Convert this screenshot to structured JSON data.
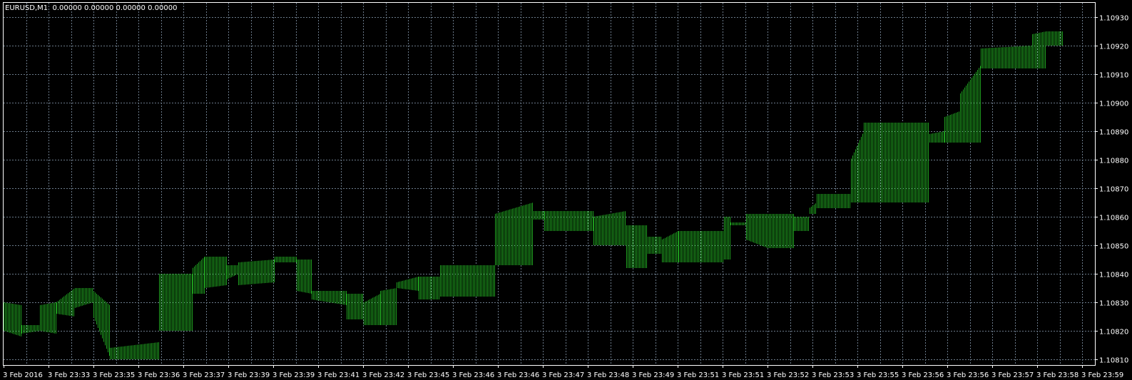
{
  "window": {
    "symbol_title": "EURUSD,M1  0.00000 0.00000 0.00000 0.00000"
  },
  "colors": {
    "background": "#000000",
    "grid": "#6b7a8a",
    "frame": "#ffffff",
    "bar": "#1f9e1f",
    "text": "#ffffff"
  },
  "price_axis": {
    "labels": [
      "1.10930",
      "1.10920",
      "1.10910",
      "1.10900",
      "1.10890",
      "1.10880",
      "1.10870",
      "1.10860",
      "1.10850",
      "1.10840",
      "1.10830",
      "1.10820",
      "1.10810"
    ],
    "min": 1.10808,
    "max": 1.10935
  },
  "time_axis": {
    "labels": [
      "3 Feb 2016",
      "3 Feb 23:33",
      "3 Feb 23:35",
      "3 Feb 23:36",
      "3 Feb 23:37",
      "3 Feb 23:39",
      "3 Feb 23:39",
      "3 Feb 23:41",
      "3 Feb 23:42",
      "3 Feb 23:45",
      "3 Feb 23:46",
      "3 Feb 23:46",
      "3 Feb 23:47",
      "3 Feb 23:48",
      "3 Feb 23:49",
      "3 Feb 23:51",
      "3 Feb 23:51",
      "3 Feb 23:52",
      "3 Feb 23:53",
      "3 Feb 23:55",
      "3 Feb 23:56",
      "3 Feb 23:56",
      "3 Feb 23:57",
      "3 Feb 23:58",
      "3 Feb 23:59"
    ]
  },
  "chart_data": {
    "type": "bar",
    "symbol": "EURUSD",
    "timeframe": "M1",
    "grid": true,
    "price_range": [
      1.10808,
      1.10935
    ],
    "bar_color": "#1f9e1f",
    "segments": [
      {
        "from": 0,
        "to": 0.016,
        "start_low": 1.1082,
        "start_high": 1.1083,
        "end_low": 1.10818,
        "end_high": 1.10829
      },
      {
        "from": 0.016,
        "to": 0.033,
        "start_low": 1.10819,
        "start_high": 1.10822,
        "end_low": 1.1082,
        "end_high": 1.10822
      },
      {
        "from": 0.033,
        "to": 0.048,
        "start_low": 1.1082,
        "start_high": 1.10829,
        "end_low": 1.10819,
        "end_high": 1.1083
      },
      {
        "from": 0.048,
        "to": 0.065,
        "start_low": 1.10826,
        "start_high": 1.1083,
        "end_low": 1.10825,
        "end_high": 1.10835
      },
      {
        "from": 0.065,
        "to": 0.082,
        "start_low": 1.10828,
        "start_high": 1.10835,
        "end_low": 1.1083,
        "end_high": 1.10835
      },
      {
        "from": 0.082,
        "to": 0.097,
        "start_low": 1.10825,
        "start_high": 1.10834,
        "end_low": 1.10811,
        "end_high": 1.10829
      },
      {
        "from": 0.097,
        "to": 0.142,
        "start_low": 1.1081,
        "start_high": 1.10814,
        "end_low": 1.1081,
        "end_high": 1.10816
      },
      {
        "from": 0.142,
        "to": 0.173,
        "start_low": 1.1082,
        "start_high": 1.1084,
        "end_low": 1.1082,
        "end_high": 1.1084
      },
      {
        "from": 0.173,
        "to": 0.184,
        "start_low": 1.10833,
        "start_high": 1.10842,
        "end_low": 1.10833,
        "end_high": 1.10846
      },
      {
        "from": 0.184,
        "to": 0.204,
        "start_low": 1.10835,
        "start_high": 1.10846,
        "end_low": 1.10836,
        "end_high": 1.10846
      },
      {
        "from": 0.204,
        "to": 0.215,
        "start_low": 1.10838,
        "start_high": 1.10843,
        "end_low": 1.1084,
        "end_high": 1.10843
      },
      {
        "from": 0.215,
        "to": 0.248,
        "start_low": 1.10836,
        "start_high": 1.10844,
        "end_low": 1.10837,
        "end_high": 1.10845
      },
      {
        "from": 0.248,
        "to": 0.268,
        "start_low": 1.10844,
        "start_high": 1.10846,
        "end_low": 1.10844,
        "end_high": 1.10846
      },
      {
        "from": 0.268,
        "to": 0.282,
        "start_low": 1.10834,
        "start_high": 1.10845,
        "end_low": 1.10833,
        "end_high": 1.10845
      },
      {
        "from": 0.282,
        "to": 0.314,
        "start_low": 1.10831,
        "start_high": 1.10834,
        "end_low": 1.10829,
        "end_high": 1.10834
      },
      {
        "from": 0.314,
        "to": 0.33,
        "start_low": 1.10824,
        "start_high": 1.10833,
        "end_low": 1.10824,
        "end_high": 1.10833
      },
      {
        "from": 0.33,
        "to": 0.345,
        "start_low": 1.10822,
        "start_high": 1.1083,
        "end_low": 1.10822,
        "end_high": 1.10833
      },
      {
        "from": 0.345,
        "to": 0.36,
        "start_low": 1.10822,
        "start_high": 1.10834,
        "end_low": 1.10822,
        "end_high": 1.10835
      },
      {
        "from": 0.36,
        "to": 0.38,
        "start_low": 1.10835,
        "start_high": 1.10837,
        "end_low": 1.10834,
        "end_high": 1.10839
      },
      {
        "from": 0.38,
        "to": 0.4,
        "start_low": 1.10831,
        "start_high": 1.10839,
        "end_low": 1.10831,
        "end_high": 1.10839
      },
      {
        "from": 0.4,
        "to": 0.45,
        "start_low": 1.10832,
        "start_high": 1.10843,
        "end_low": 1.10832,
        "end_high": 1.10843
      },
      {
        "from": 0.45,
        "to": 0.485,
        "start_low": 1.10843,
        "start_high": 1.10861,
        "end_low": 1.10843,
        "end_high": 1.10865
      },
      {
        "from": 0.485,
        "to": 0.495,
        "start_low": 1.10859,
        "start_high": 1.10862,
        "end_low": 1.10859,
        "end_high": 1.10862
      },
      {
        "from": 0.495,
        "to": 0.54,
        "start_low": 1.10855,
        "start_high": 1.10862,
        "end_low": 1.10855,
        "end_high": 1.10862
      },
      {
        "from": 0.54,
        "to": 0.57,
        "start_low": 1.1085,
        "start_high": 1.1086,
        "end_low": 1.1085,
        "end_high": 1.10862
      },
      {
        "from": 0.57,
        "to": 0.59,
        "start_low": 1.10842,
        "start_high": 1.10857,
        "end_low": 1.10842,
        "end_high": 1.10857
      },
      {
        "from": 0.59,
        "to": 0.603,
        "start_low": 1.10847,
        "start_high": 1.10853,
        "end_low": 1.10847,
        "end_high": 1.10853
      },
      {
        "from": 0.603,
        "to": 0.618,
        "start_low": 1.10844,
        "start_high": 1.10852,
        "end_low": 1.10844,
        "end_high": 1.10855
      },
      {
        "from": 0.618,
        "to": 0.66,
        "start_low": 1.10844,
        "start_high": 1.10855,
        "end_low": 1.10844,
        "end_high": 1.10855
      },
      {
        "from": 0.66,
        "to": 0.666,
        "start_low": 1.10845,
        "start_high": 1.1086,
        "end_low": 1.10845,
        "end_high": 1.1086
      },
      {
        "from": 0.666,
        "to": 0.68,
        "start_low": 1.10857,
        "start_high": 1.10858,
        "end_low": 1.10857,
        "end_high": 1.10858
      },
      {
        "from": 0.68,
        "to": 0.7,
        "start_low": 1.10852,
        "start_high": 1.10861,
        "end_low": 1.10849,
        "end_high": 1.10861
      },
      {
        "from": 0.7,
        "to": 0.724,
        "start_low": 1.10849,
        "start_high": 1.10861,
        "end_low": 1.10849,
        "end_high": 1.10861
      },
      {
        "from": 0.724,
        "to": 0.738,
        "start_low": 1.10855,
        "start_high": 1.1086,
        "end_low": 1.10855,
        "end_high": 1.1086
      },
      {
        "from": 0.738,
        "to": 0.745,
        "start_low": 1.10861,
        "start_high": 1.10863,
        "end_low": 1.10861,
        "end_high": 1.10865
      },
      {
        "from": 0.745,
        "to": 0.776,
        "start_low": 1.10863,
        "start_high": 1.10868,
        "end_low": 1.10863,
        "end_high": 1.10868
      },
      {
        "from": 0.776,
        "to": 0.788,
        "start_low": 1.10865,
        "start_high": 1.1088,
        "end_low": 1.10865,
        "end_high": 1.1089
      },
      {
        "from": 0.788,
        "to": 0.848,
        "start_low": 1.10865,
        "start_high": 1.10893,
        "end_low": 1.10865,
        "end_high": 1.10893
      },
      {
        "from": 0.848,
        "to": 0.862,
        "start_low": 1.10886,
        "start_high": 1.10889,
        "end_low": 1.10886,
        "end_high": 1.1089
      },
      {
        "from": 0.862,
        "to": 0.876,
        "start_low": 1.10886,
        "start_high": 1.10895,
        "end_low": 1.10886,
        "end_high": 1.10897
      },
      {
        "from": 0.876,
        "to": 0.895,
        "start_low": 1.10886,
        "start_high": 1.10903,
        "end_low": 1.10886,
        "end_high": 1.10913
      },
      {
        "from": 0.895,
        "to": 0.942,
        "start_low": 1.10912,
        "start_high": 1.10919,
        "end_low": 1.10912,
        "end_high": 1.1092
      },
      {
        "from": 0.942,
        "to": 0.955,
        "start_low": 1.10912,
        "start_high": 1.10924,
        "end_low": 1.10912,
        "end_high": 1.10925
      },
      {
        "from": 0.955,
        "to": 0.97,
        "start_low": 1.1092,
        "start_high": 1.10925,
        "end_low": 1.1092,
        "end_high": 1.10925
      }
    ]
  }
}
